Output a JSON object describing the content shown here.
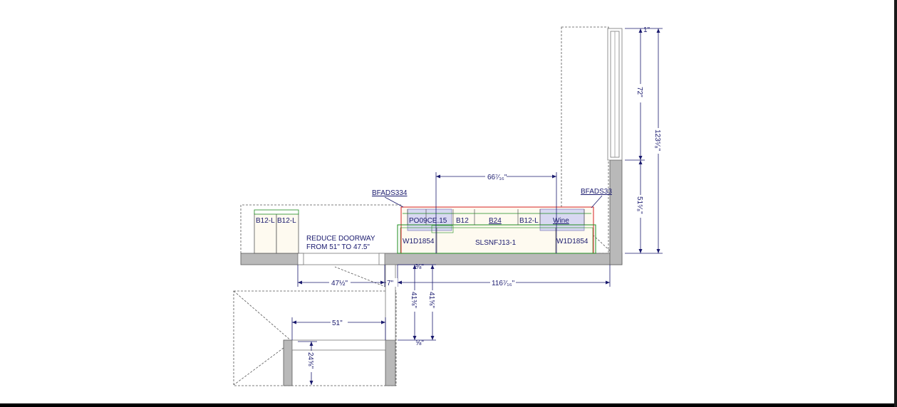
{
  "cabinets": {
    "b12l_a": "B12-L",
    "b12l_b": "B12-L",
    "po09": "PO09CE.15",
    "b12": "B12",
    "b24": "B24",
    "b12l_c": "B12-L",
    "wine": "Wine",
    "w1d1854_left": "W1D1854",
    "slsnfj": "SLSNFJ13-1",
    "w1d1854_right": "W1D1854"
  },
  "callouts": {
    "bfads_left": "BFADS334",
    "bfads_right": "BFADS33"
  },
  "note": {
    "line1": "REDUCE DOORWAY",
    "line2": "FROM 51\" TO 47.5\""
  },
  "dimensions": {
    "top_span": "66⁷⁄₁₆\"",
    "wall_upper": "72\"",
    "wall_total": "123⁵⁄₈\"",
    "wall_lower": "51⁵⁄₈\"",
    "top_small": "1\"",
    "doorway": "47½\"",
    "seven": "7\"",
    "main_run": "116⁷⁄₁₆\"",
    "depth_a": "41⅜\"",
    "depth_b": "41⅝\"",
    "small_a": "⅜\"",
    "small_b": "⅝\"",
    "opening": "51\"",
    "lower_depth": "24⅝\""
  },
  "colors": {
    "wall_fill": "#b9b9b9",
    "dim_line": "#1a1a6e",
    "upper_cabinet_outline": "#d62020",
    "base_cabinet_outline": "#1e8c1e",
    "highlight_fill": "#d8d8f2"
  }
}
